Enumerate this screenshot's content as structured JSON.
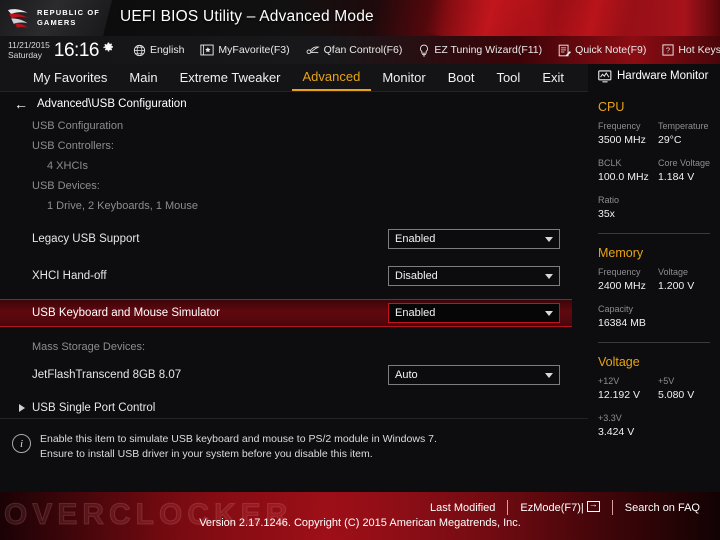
{
  "header": {
    "logo_line1": "REPUBLIC OF",
    "logo_line2": "GAMERS",
    "title": "UEFI BIOS Utility – Advanced Mode",
    "logo_icon": "rog-eye-icon"
  },
  "toolbar": {
    "date": "11/21/2015",
    "weekday": "Saturday",
    "time": "16:16",
    "gear_icon": "gear-icon",
    "items": [
      {
        "label": "English",
        "icon": "globe-icon"
      },
      {
        "label": "MyFavorite(F3)",
        "icon": "star-card-icon"
      },
      {
        "label": "Qfan Control(F6)",
        "icon": "fan-icon"
      },
      {
        "label": "EZ Tuning Wizard(F11)",
        "icon": "lightbulb-icon"
      },
      {
        "label": "Quick Note(F9)",
        "icon": "note-pencil-icon"
      },
      {
        "label": "Hot Keys",
        "icon": "question-box-icon"
      }
    ]
  },
  "nav": {
    "tabs": [
      {
        "label": "My Favorites",
        "active": false
      },
      {
        "label": "Main",
        "active": false
      },
      {
        "label": "Extreme Tweaker",
        "active": false
      },
      {
        "label": "Advanced",
        "active": true
      },
      {
        "label": "Monitor",
        "active": false
      },
      {
        "label": "Boot",
        "active": false
      },
      {
        "label": "Tool",
        "active": false
      },
      {
        "label": "Exit",
        "active": false
      }
    ],
    "active_color": "#e8a317"
  },
  "main": {
    "back_arrow": "←",
    "breadcrumb": "Advanced\\USB Configuration",
    "info_lines": [
      {
        "text": "USB Configuration",
        "indent": false
      },
      {
        "text": "USB Controllers:",
        "indent": false
      },
      {
        "text": "4 XHCIs",
        "indent": true
      },
      {
        "text": "USB Devices:",
        "indent": false
      },
      {
        "text": "1 Drive, 2 Keyboards, 1 Mouse",
        "indent": true
      }
    ],
    "settings": [
      {
        "label": "Legacy USB Support",
        "value": "Enabled",
        "selected": false
      },
      {
        "label": "XHCI Hand-off",
        "value": "Disabled",
        "selected": false
      },
      {
        "label": "USB Keyboard and Mouse Simulator",
        "value": "Enabled",
        "selected": true
      }
    ],
    "storage_header": "Mass Storage Devices:",
    "storage_device": {
      "label": "JetFlashTranscend 8GB 8.07",
      "value": "Auto"
    },
    "submenu": {
      "label": "USB Single Port Control",
      "arrow_icon": "triangle-right-icon"
    },
    "help_icon": "info-icon",
    "help_line1": "Enable this item to simulate USB keyboard and mouse to PS/2 module in Windows 7.",
    "help_line2": "Ensure to install USB driver in your system before you disable this item.",
    "selected_row_color": "#b01420"
  },
  "sidebar": {
    "header": "Hardware Monitor",
    "header_icon": "monitor-icon",
    "sections": [
      {
        "title": "CPU",
        "rows": [
          [
            {
              "key": "Frequency",
              "value": "3500 MHz"
            },
            {
              "key": "Temperature",
              "value": "29°C"
            }
          ],
          [
            {
              "key": "BCLK",
              "value": "100.0 MHz"
            },
            {
              "key": "Core Voltage",
              "value": "1.184 V"
            }
          ],
          [
            {
              "key": "Ratio",
              "value": "35x"
            }
          ]
        ]
      },
      {
        "title": "Memory",
        "rows": [
          [
            {
              "key": "Frequency",
              "value": "2400 MHz"
            },
            {
              "key": "Voltage",
              "value": "1.200 V"
            }
          ],
          [
            {
              "key": "Capacity",
              "value": "16384 MB"
            }
          ]
        ]
      },
      {
        "title": "Voltage",
        "rows": [
          [
            {
              "key": "+12V",
              "value": "12.192 V"
            },
            {
              "key": "+5V",
              "value": "5.080 V"
            }
          ],
          [
            {
              "key": "+3.3V",
              "value": "3.424 V"
            }
          ]
        ]
      }
    ],
    "title_color": "#e8a317"
  },
  "footer": {
    "watermark": "OVERCLOCKER",
    "last_modified": "Last Modified",
    "ez_mode": "EzMode(F7)|",
    "search_faq": "Search on FAQ",
    "version": "Version 2.17.1246. Copyright (C) 2015 American Megatrends, Inc."
  }
}
